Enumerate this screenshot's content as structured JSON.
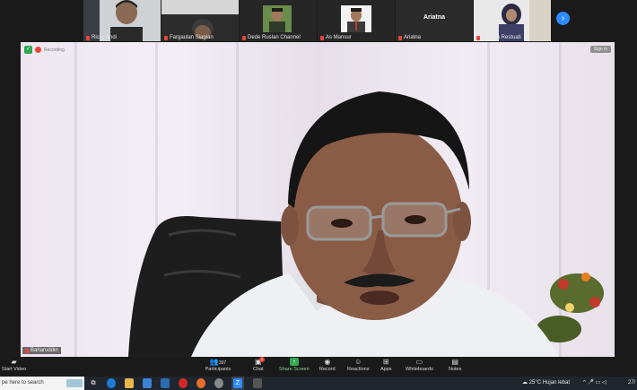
{
  "participants_strip": {
    "tiles": [
      {
        "name": "Ricky Andi"
      },
      {
        "name": "Fargaulan Siagian"
      },
      {
        "name": "Dede Ruslan Channel"
      },
      {
        "name": "As Mansur"
      },
      {
        "name": "Ariatna",
        "center_label": "Ariatna"
      },
      {
        "name": "Martina Restuati"
      }
    ],
    "next_icon": "chevron-right-icon"
  },
  "main_video": {
    "speaker_name": "Baharuddin",
    "recording_label": "Recording",
    "signin_label": "Sign in"
  },
  "toolbar": {
    "start_video": "Start Video",
    "participants_label": "Participants",
    "participants_count": "397",
    "chat_label": "Chat",
    "chat_badge": "1",
    "share_label": "Share Screen",
    "record_label": "Record",
    "reactions_label": "Reactions",
    "apps_label": "Apps",
    "whiteboards_label": "Whiteboards",
    "notes_label": "Notes"
  },
  "taskbar": {
    "search_placeholder": "pe here to search",
    "temperature": "25°C",
    "weather": "Hujan lebat",
    "time": "27/"
  },
  "colors": {
    "accent_blue": "#2d8cff",
    "share_green": "#2fa84f",
    "mute_red": "#e8453c"
  }
}
